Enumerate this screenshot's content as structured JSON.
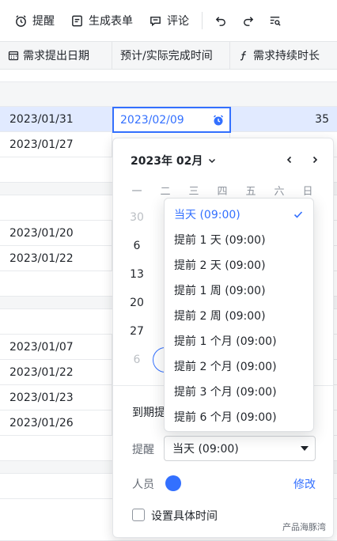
{
  "toolbar": {
    "remind_label": "提醒",
    "form_label": "生成表单",
    "comment_label": "评论"
  },
  "columns": {
    "col1": "需求提出日期",
    "col2": "预计/实际完成时间",
    "col3": "需求持续时长"
  },
  "rows": [
    {
      "date": "2023/01/31",
      "duration": "35"
    },
    {
      "date": "2023/01/27"
    },
    {
      "date": "2023/01/20"
    },
    {
      "date": "2023/01/22"
    },
    {
      "date": "2023/01/07"
    },
    {
      "date": "2023/01/22"
    },
    {
      "date": "2023/01/23"
    },
    {
      "date": "2023/01/26"
    }
  ],
  "edit_cell": {
    "value": "2023/02/09"
  },
  "calendar": {
    "month_label": "2023年 02月",
    "weekdays": [
      "一",
      "二",
      "三",
      "四",
      "五",
      "六",
      "日"
    ],
    "visible_days": [
      "30",
      "6",
      "13",
      "20",
      "27",
      "6"
    ]
  },
  "reminder_menu": {
    "items": [
      "当天 (09:00)",
      "提前 1 天 (09:00)",
      "提前 2 天 (09:00)",
      "提前 1 周 (09:00)",
      "提前 2 周 (09:00)",
      "提前 1 个月 (09:00)",
      "提前 2 个月 (09:00)",
      "提前 3 个月 (09:00)",
      "提前 6 个月 (09:00)"
    ],
    "selected_index": 0
  },
  "reminder_form": {
    "due_label": "到期提",
    "remind_label": "提醒",
    "remind_value": "当天 (09:00)",
    "person_label": "人员",
    "modify_label": "修改",
    "specific_time_label": "设置具体时间"
  },
  "watermark": {
    "right": "产品海豚湾"
  },
  "colors": {
    "accent": "#3370ff",
    "selected_row": "#e1eaff"
  }
}
